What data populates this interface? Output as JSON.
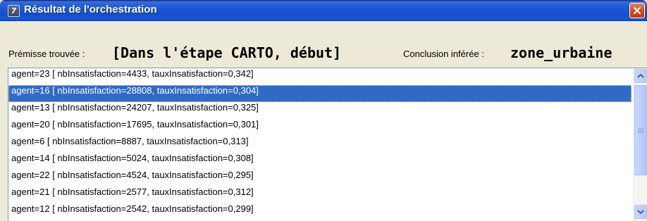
{
  "window": {
    "title": "Résultat de l'orchestration",
    "icon_glyph": "7",
    "icon_name": "app-icon",
    "close_icon": "close-icon",
    "colors": {
      "titlebar": "#1450cc",
      "close_button": "#d4441f",
      "selection": "#316ac5",
      "background": "#ece9d8"
    }
  },
  "header": {
    "premise_label": "Prémisse trouvée :",
    "premise_value": "[Dans l'étape CARTO, début]",
    "conclusion_label": "Conclusion inférée :",
    "conclusion_value": "zone_urbaine"
  },
  "list": {
    "selected_index": 1,
    "items": [
      "agent=23 [ nbInsatisfaction=4433, tauxInsatisfaction=0,342]",
      "agent=16 [ nbInsatisfaction=28808, tauxInsatisfaction=0,304]",
      "agent=13 [ nbInsatisfaction=24207, tauxInsatisfaction=0,325]",
      "agent=20 [ nbInsatisfaction=17695, tauxInsatisfaction=0,301]",
      "agent=6 [ nbInsatisfaction=8887, tauxInsatisfaction=0,313]",
      "agent=14 [ nbInsatisfaction=5024, tauxInsatisfaction=0,308]",
      "agent=22 [ nbInsatisfaction=4524, tauxInsatisfaction=0,295]",
      "agent=21 [ nbInsatisfaction=2577, tauxInsatisfaction=0,312]",
      "agent=12 [ nbInsatisfaction=2542, tauxInsatisfaction=0,299]"
    ]
  },
  "scrollbar": {
    "up_icon": "scroll-up-arrow-icon",
    "down_icon": "scroll-down-arrow-icon",
    "grip_icon": "scroll-grip-icon"
  }
}
